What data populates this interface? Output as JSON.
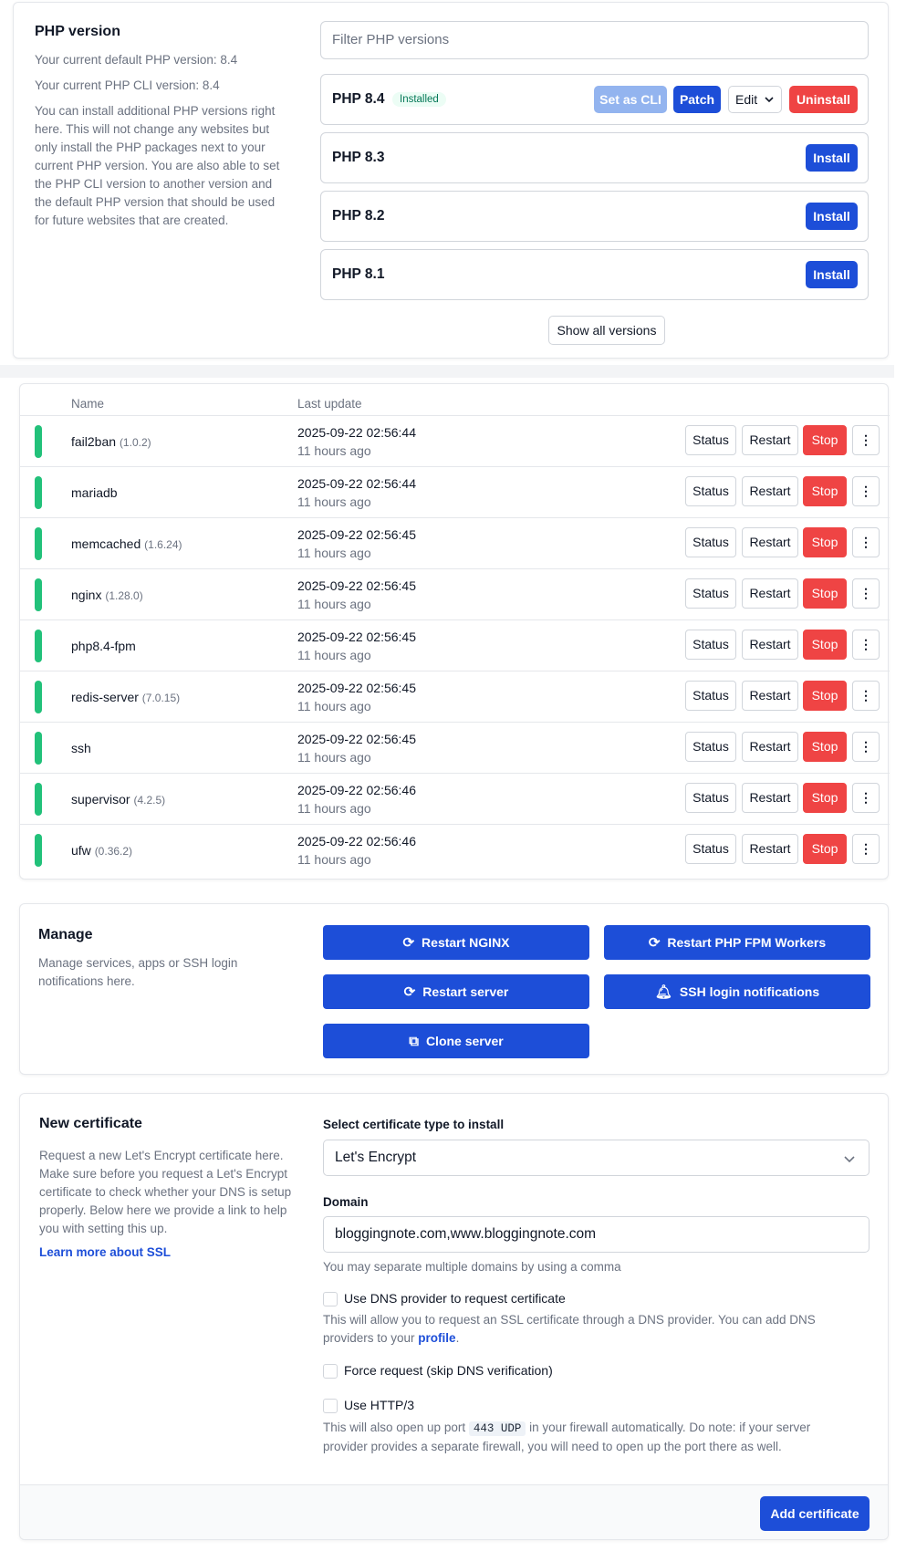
{
  "php": {
    "title": "PHP version",
    "default_version": "Your current default PHP version: 8.4",
    "cli_version": "Your current PHP CLI version: 8.4",
    "description": "You can install additional PHP versions right here. This will not change any websites but only install the PHP packages next to your current PHP version. You are also able to set the PHP CLI version to another version and the default PHP version that should be used for future websites that are created.",
    "filter_placeholder": "Filter PHP versions",
    "installed_badge": "Installed",
    "set_cli_label": "Set as CLI",
    "patch_label": "Patch",
    "edit_label": "Edit",
    "uninstall_label": "Uninstall",
    "install_label": "Install",
    "versions": [
      "PHP 8.4",
      "PHP 8.3",
      "PHP 8.2",
      "PHP 8.1"
    ],
    "show_all_label": "Show all versions"
  },
  "services": {
    "col_name": "Name",
    "col_update": "Last update",
    "status_label": "Status",
    "restart_label": "Restart",
    "stop_label": "Stop",
    "more_glyph": "⋮",
    "rows": [
      {
        "name": "fail2ban",
        "version": "(1.0.2)",
        "date": "2025-09-22 02:56:44",
        "ago": "11 hours ago"
      },
      {
        "name": "mariadb",
        "version": "",
        "date": "2025-09-22 02:56:44",
        "ago": "11 hours ago"
      },
      {
        "name": "memcached",
        "version": "(1.6.24)",
        "date": "2025-09-22 02:56:45",
        "ago": "11 hours ago"
      },
      {
        "name": "nginx",
        "version": "(1.28.0)",
        "date": "2025-09-22 02:56:45",
        "ago": "11 hours ago"
      },
      {
        "name": "php8.4-fpm",
        "version": "",
        "date": "2025-09-22 02:56:45",
        "ago": "11 hours ago"
      },
      {
        "name": "redis-server",
        "version": "(7.0.15)",
        "date": "2025-09-22 02:56:45",
        "ago": "11 hours ago"
      },
      {
        "name": "ssh",
        "version": "",
        "date": "2025-09-22 02:56:45",
        "ago": "11 hours ago"
      },
      {
        "name": "supervisor",
        "version": "(4.2.5)",
        "date": "2025-09-22 02:56:46",
        "ago": "11 hours ago"
      },
      {
        "name": "ufw",
        "version": "(0.36.2)",
        "date": "2025-09-22 02:56:46",
        "ago": "11 hours ago"
      }
    ]
  },
  "manage": {
    "title": "Manage",
    "description": "Manage services, apps or SSH login notifications here.",
    "restart_nginx": "Restart NGINX",
    "restart_php_fpm": "Restart PHP FPM Workers",
    "restart_server": "Restart server",
    "ssh_notifications": "SSH login notifications",
    "clone_server": "Clone server"
  },
  "certificate": {
    "title": "New certificate",
    "description": "Request a new Let's Encrypt certificate here. Make sure before you request a Let's Encrypt certificate to check whether your DNS is setup properly. Below here we provide a link to help you with setting this up.",
    "learn_more": "Learn more about SSL",
    "type_label": "Select certificate type to install",
    "type_value": "Let's Encrypt",
    "domain_label": "Domain",
    "domain_value": "bloggingnote.com,www.bloggingnote.com",
    "domain_hint": "You may separate multiple domains by using a comma",
    "dns_provider_label": "Use DNS provider to request certificate",
    "dns_provider_hint_pre": "This will allow you to request an SSL certificate through a DNS provider. You can add DNS providers to your ",
    "dns_provider_hint_link": "profile",
    "dns_provider_hint_post": ".",
    "force_label": "Force request (skip DNS verification)",
    "http3_label": "Use HTTP/3",
    "http3_hint_pre": "This will also open up port ",
    "http3_code": "443 UDP",
    "http3_hint_post": " in your firewall automatically. Do note: if your server provider provides a separate firewall, you will need to open up the port there as well.",
    "add_label": "Add certificate"
  },
  "colors": {
    "primary": "#1d4ed8",
    "danger": "#ef4444",
    "success": "#22c17a"
  }
}
